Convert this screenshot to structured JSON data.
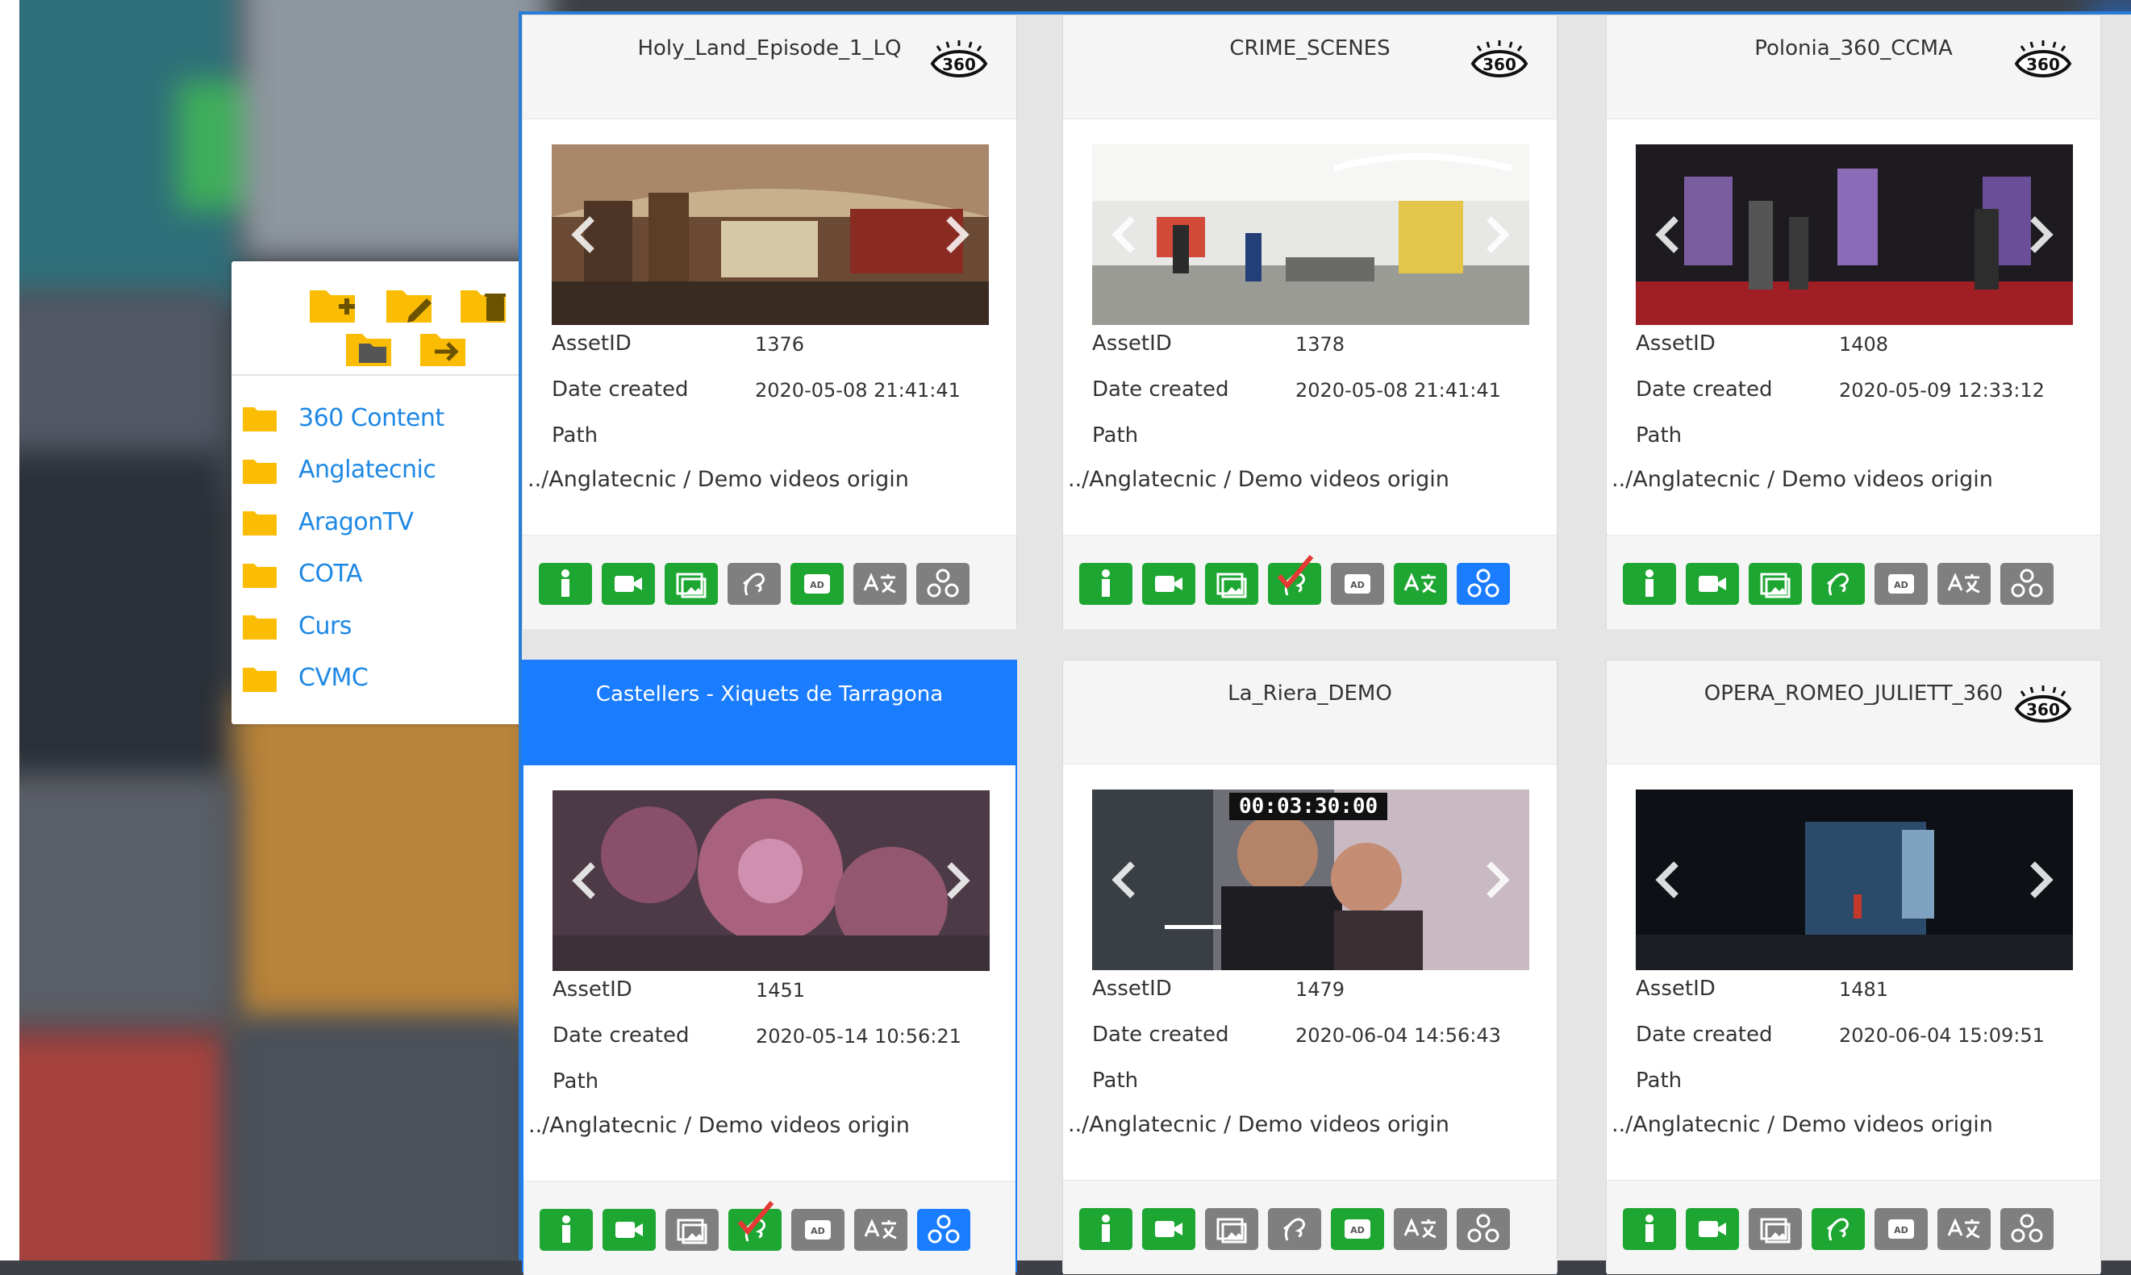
{
  "colors": {
    "accent": "#1a7cff",
    "success": "#1ea632",
    "inactive": "#7f7f7f",
    "folder": "#fbbc04",
    "link": "#1e88e5"
  },
  "folder_panel": {
    "tools": [
      "folder-add-icon",
      "folder-edit-icon",
      "folder-delete-icon",
      "folder-icon",
      "folder-move-icon"
    ],
    "folders": [
      {
        "label": "360 Content"
      },
      {
        "label": "Anglatecnic"
      },
      {
        "label": "AragonTV"
      },
      {
        "label": "COTA"
      },
      {
        "label": "Curs"
      },
      {
        "label": "CVMC"
      }
    ]
  },
  "labels": {
    "asset_id": "AssetID",
    "date_created": "Date created",
    "path": "Path"
  },
  "cards": [
    {
      "title": "Holy_Land_Episode_1_LQ",
      "is360": true,
      "asset_id": "1376",
      "date": "2020-05-08 21:41:41",
      "path": "../Anglatecnic / Demo videos origin",
      "actions": [
        "green",
        "green",
        "green",
        "grey",
        "green",
        "grey",
        "grey"
      ],
      "subtitle_checked": false
    },
    {
      "title": "CRIME_SCENES",
      "is360": true,
      "asset_id": "1378",
      "date": "2020-05-08 21:41:41",
      "path": "../Anglatecnic / Demo videos origin",
      "actions": [
        "green",
        "green",
        "green",
        "green",
        "grey",
        "green",
        "blue"
      ],
      "subtitle_checked": true
    },
    {
      "title": "Polonia_360_CCMA",
      "is360": true,
      "asset_id": "1408",
      "date": "2020-05-09 12:33:12",
      "path": "../Anglatecnic / Demo videos origin",
      "actions": [
        "green",
        "green",
        "green",
        "green",
        "grey",
        "grey",
        "grey"
      ],
      "subtitle_checked": false
    },
    {
      "title": "Castellers - Xiquets de Tarragona",
      "is360": false,
      "asset_id": "1451",
      "date": "2020-05-14 10:56:21",
      "path": "../Anglatecnic / Demo videos origin",
      "actions": [
        "green",
        "green",
        "grey",
        "green",
        "grey",
        "grey",
        "blue"
      ],
      "subtitle_checked": true
    },
    {
      "title": "La_Riera_DEMO",
      "is360": false,
      "asset_id": "1479",
      "date": "2020-06-04 14:56:43",
      "path": "../Anglatecnic / Demo videos origin",
      "actions": [
        "green",
        "green",
        "grey",
        "grey",
        "green",
        "grey",
        "grey"
      ],
      "subtitle_checked": false,
      "timecode": "00:03:30:00"
    },
    {
      "title": "OPERA_ROMEO_JULIETT_360",
      "is360": true,
      "asset_id": "1481",
      "date": "2020-06-04 15:09:51",
      "path": "../Anglatecnic / Demo videos origin",
      "actions": [
        "green",
        "green",
        "grey",
        "green",
        "grey",
        "grey",
        "grey"
      ],
      "subtitle_checked": false
    }
  ],
  "action_icons": [
    "info-icon",
    "video-icon",
    "image-gallery-icon",
    "sign-language-icon",
    "audio-description-icon",
    "translate-icon",
    "share-icon"
  ]
}
